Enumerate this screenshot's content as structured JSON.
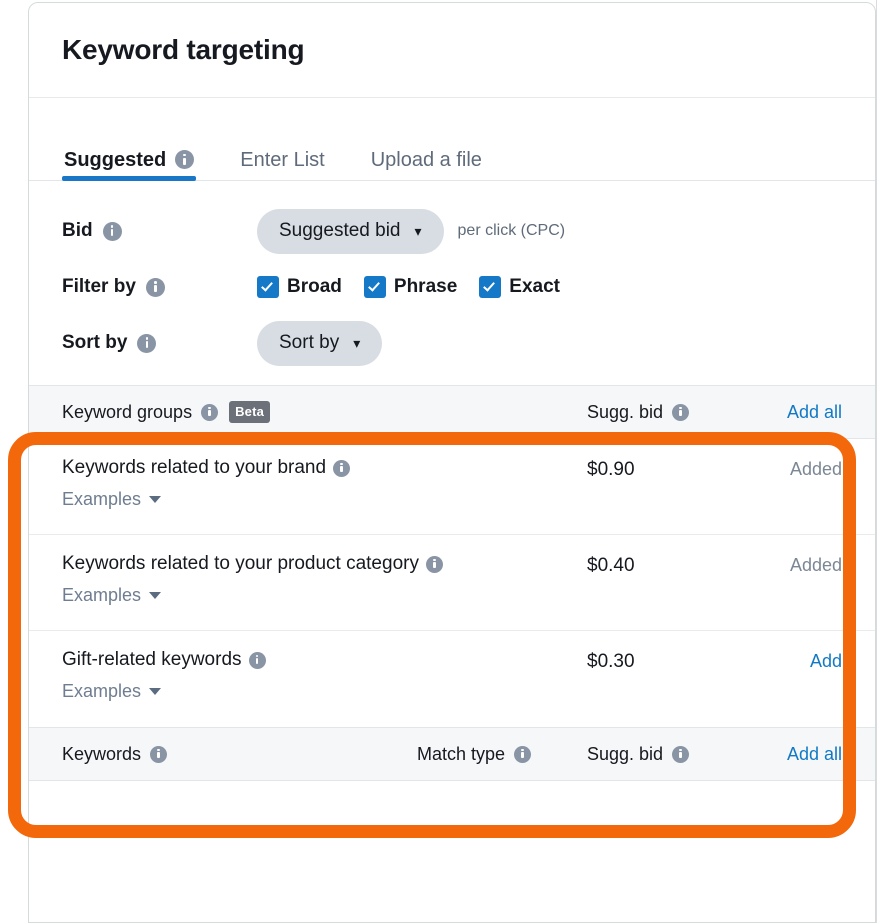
{
  "card": {
    "title": "Keyword targeting"
  },
  "tabs": [
    {
      "label": "Suggested",
      "active": true,
      "has_info": true
    },
    {
      "label": "Enter List",
      "active": false,
      "has_info": false
    },
    {
      "label": "Upload a file",
      "active": false,
      "has_info": false
    }
  ],
  "settings": {
    "bid": {
      "label": "Bid",
      "selected": "Suggested bid",
      "caret": "chevron-down",
      "note": "per click (CPC)"
    },
    "filter_by": {
      "label": "Filter by",
      "options": [
        {
          "label": "Broad",
          "checked": true
        },
        {
          "label": "Phrase",
          "checked": true
        },
        {
          "label": "Exact",
          "checked": true
        }
      ]
    },
    "sort_by": {
      "label": "Sort by",
      "selected": "Sort by",
      "caret": "chevron-down"
    }
  },
  "keyword_groups_table": {
    "header": {
      "name": "Keyword groups",
      "badge": "Beta",
      "bid": "Sugg. bid",
      "action": "Add all"
    },
    "rows": [
      {
        "name": "Keywords related to your brand",
        "examples_label": "Examples",
        "bid": "$0.90",
        "action": "Added",
        "action_state": "disabled"
      },
      {
        "name": "Keywords related to your product category",
        "examples_label": "Examples",
        "bid": "$0.40",
        "action": "Added",
        "action_state": "disabled"
      },
      {
        "name": "Gift-related keywords",
        "examples_label": "Examples",
        "bid": "$0.30",
        "action": "Add",
        "action_state": "enabled"
      }
    ]
  },
  "keywords_table": {
    "header": {
      "name": "Keywords",
      "match_type": "Match type",
      "bid": "Sugg. bid",
      "action": "Add all"
    }
  },
  "colors": {
    "link_blue": "#1279c5",
    "tab_underline": "#1a76c7",
    "checkbox_blue": "#1579c8",
    "annotation_orange": "#f4680c",
    "badge_gray": "#6b7079",
    "info_icon_gray": "#8995a4",
    "pill_gray": "#d8dde4",
    "header_row_bg": "#f6f7f8"
  }
}
